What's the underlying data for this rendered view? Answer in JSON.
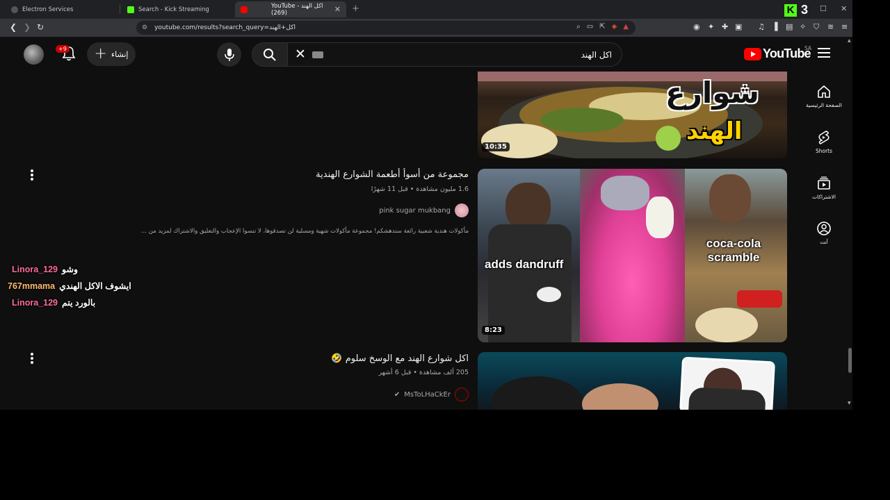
{
  "browser": {
    "tabs": [
      {
        "title": "Electron Services"
      },
      {
        "title": "Search - Kick Streaming"
      },
      {
        "title": "YouTube - اكل الهند (269)",
        "active": true
      }
    ],
    "new_tab": "+",
    "url": "youtube.com/results?search_query=اكل+الهند",
    "kick_count": "3",
    "kick_logo": "K",
    "window_controls": [
      "—",
      "☐",
      "✕"
    ]
  },
  "youtube": {
    "logo_text": "YouTube",
    "region": "SA",
    "search_query": "اكل الهند",
    "create_label": "إنشاء",
    "notification_count": "+9",
    "sidebar": [
      {
        "label": "الصفحة الرئيسية",
        "icon": "home-icon"
      },
      {
        "label": "Shorts",
        "icon": "shorts-icon"
      },
      {
        "label": "الاشتراكات",
        "icon": "subscriptions-icon"
      },
      {
        "label": "أنت",
        "icon": "you-icon"
      }
    ]
  },
  "results": [
    {
      "duration": "10:35",
      "thumb_text_lines": [
        "شوارع",
        "الهند"
      ]
    },
    {
      "title": "مجموعة من أسوأ أطعمة الشوارع الهندية",
      "views": "1.6 مليون مشاهدة",
      "age": "قبل 11 شهرًا",
      "channel": "pink sugar mukbang",
      "description": "مأكولات هندية شعبية رائعة ستدهشكم! مجموعة مأكولات شهية ومسلية لن تصدقوها، لا تنسوا الإعجاب والتعليق والاشتراك لمزيد من ...",
      "duration": "8:23",
      "thumb_captions": [
        "adds dandruff",
        "coca-cola scramble"
      ]
    },
    {
      "title": "اكل شوارع الهند مع الوسخ سلوم 🤣",
      "views": "205 ألف مشاهدة",
      "age": "قبل 6 أشهر",
      "channel": "MsToLHaCkEr",
      "verified": true
    }
  ],
  "chat": [
    {
      "user": "Linora_129",
      "message": "وشو"
    },
    {
      "user": "767mmama",
      "message": "ايشوف الاكل الهندي"
    },
    {
      "user": "Linora_129",
      "message": "بالورد يتم"
    }
  ]
}
